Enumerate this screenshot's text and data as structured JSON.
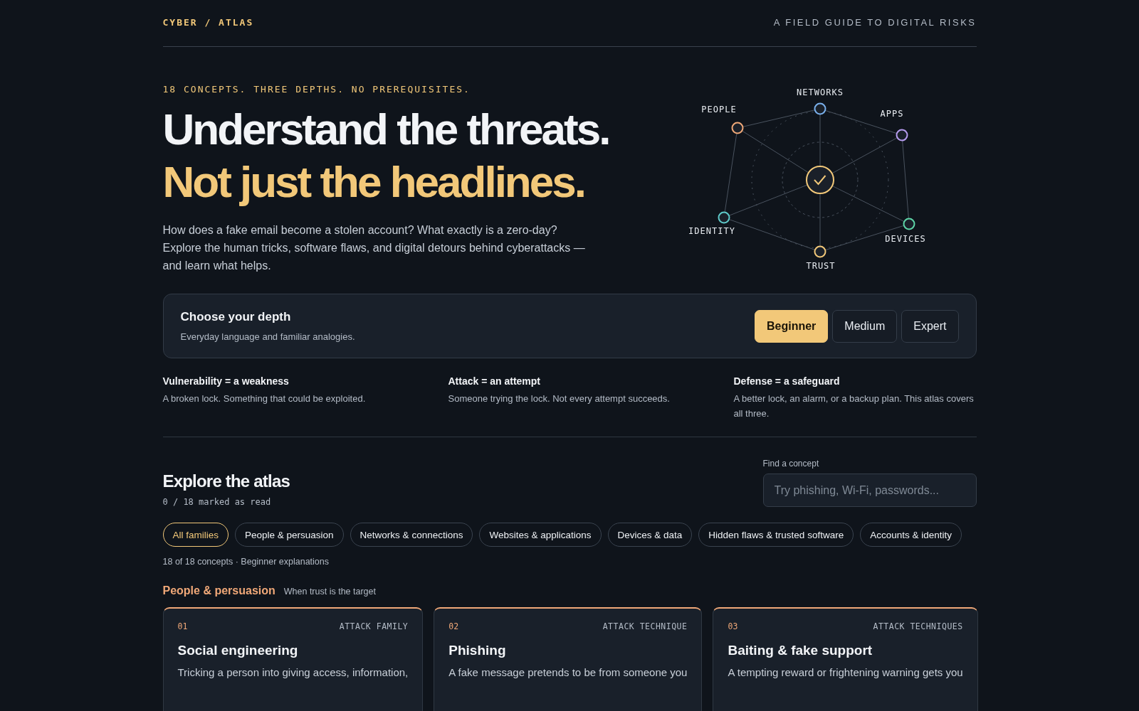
{
  "header": {
    "brand": "CYBER / ATLAS",
    "tagline": "A FIELD GUIDE TO DIGITAL RISKS"
  },
  "hero": {
    "eyebrow": "18 CONCEPTS. THREE DEPTHS. NO PREREQUISITES.",
    "headline_1": "Understand the threats.",
    "headline_2": "Not just the headlines.",
    "intro": "How does a fake email become a stolen account? What exactly is a zero-day? Explore the human tricks, software flaws, and digital detours behind cyberattacks — and learn what helps."
  },
  "radar": {
    "nodes": [
      {
        "label": "NETWORKS",
        "color": "#7ab0ec"
      },
      {
        "label": "APPS",
        "color": "#b79cf0"
      },
      {
        "label": "DEVICES",
        "color": "#5ed6a8"
      },
      {
        "label": "TRUST",
        "color": "#f2c879"
      },
      {
        "label": "IDENTITY",
        "color": "#5ec9c9"
      },
      {
        "label": "PEOPLE",
        "color": "#f0a878"
      }
    ]
  },
  "depth": {
    "title": "Choose your depth",
    "description": "Everyday language and familiar analogies.",
    "options": [
      {
        "label": "Beginner",
        "selected": true
      },
      {
        "label": "Medium",
        "selected": false
      },
      {
        "label": "Expert",
        "selected": false
      }
    ]
  },
  "definitions": [
    {
      "term": "Vulnerability = a weakness",
      "text": "A broken lock. Something that could be exploited."
    },
    {
      "term": "Attack = an attempt",
      "text": "Someone trying the lock. Not every attempt succeeds."
    },
    {
      "term": "Defense = a safeguard",
      "text": "A better lock, an alarm, or a backup plan. This atlas covers all three."
    }
  ],
  "explore": {
    "title": "Explore the atlas",
    "progress": "0 / 18 marked as read",
    "search_label": "Find a concept",
    "search_placeholder": "Try phishing, Wi-Fi, passwords...",
    "filters": [
      {
        "label": "All families",
        "selected": true
      },
      {
        "label": "People & persuasion",
        "selected": false
      },
      {
        "label": "Networks & connections",
        "selected": false
      },
      {
        "label": "Websites & applications",
        "selected": false
      },
      {
        "label": "Devices & data",
        "selected": false
      },
      {
        "label": "Hidden flaws & trusted software",
        "selected": false
      },
      {
        "label": "Accounts & identity",
        "selected": false
      }
    ],
    "count": "18 of 18 concepts · Beginner explanations"
  },
  "section": {
    "title": "People & persuasion",
    "subtitle": "When trust is the target",
    "color": "#f0a878",
    "cards": [
      {
        "number": "01",
        "type": "ATTACK FAMILY",
        "title": "Social engineering",
        "text": "Tricking a person into giving access, information,"
      },
      {
        "number": "02",
        "type": "ATTACK TECHNIQUE",
        "title": "Phishing",
        "text": "A fake message pretends to be from someone you"
      },
      {
        "number": "03",
        "type": "ATTACK TECHNIQUES",
        "title": "Baiting & fake support",
        "text": "A tempting reward or frightening warning gets you"
      }
    ]
  }
}
